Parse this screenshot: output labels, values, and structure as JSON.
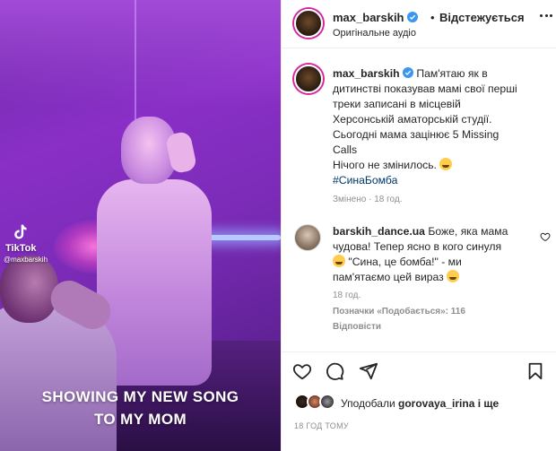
{
  "media": {
    "watermark_brand": "TikTok",
    "watermark_user": "@maxbarskih",
    "caption_line1": "SHOWING MY NEW SONG",
    "caption_line2": "TO MY MOM"
  },
  "header": {
    "username": "max_barskih",
    "separator": "•",
    "follow_status": "Відстежується",
    "audio": "Оригінальне аудіо",
    "more_icon": "more-horizontal-icon"
  },
  "caption": {
    "username": "max_barskih",
    "line1": "Пам'ятаю як в",
    "line2": "дитинстві показував мамі свої перші",
    "line3": "треки записані в місцевій",
    "line4": "Херсонській аматорській студії.",
    "line5": "Сьогодні мама зацінює 5 Missing",
    "line6": "Calls",
    "line7": "Нічого не змінилось.",
    "hashtag": "#СинаБомба",
    "meta": "Змінено · 18 год."
  },
  "comment": {
    "username": "barskih_dance.ua",
    "line1": "Боже, яка мама",
    "line2": "чудова! Тепер ясно в кого синуля",
    "line3": "\"Сина, це бомба!\" - ми",
    "line4": "пам'ятаємо цей вираз",
    "time": "18 год.",
    "likes": "Позначки «Подобається»: 116",
    "reply": "Відповісти"
  },
  "actions": {
    "like_icon": "heart-icon",
    "comment_icon": "comment-icon",
    "share_icon": "share-icon",
    "save_icon": "bookmark-icon"
  },
  "likes": {
    "prefix": "Уподобали",
    "user": "gorovaya_irina",
    "suffix": "і ще"
  },
  "post_time": "18 ГОД ТОМУ",
  "colors": {
    "text": "#262626",
    "muted": "#8e8e8e",
    "link": "#00376b",
    "verified": "#3897f0",
    "caption_overlay": "#ffffff"
  }
}
